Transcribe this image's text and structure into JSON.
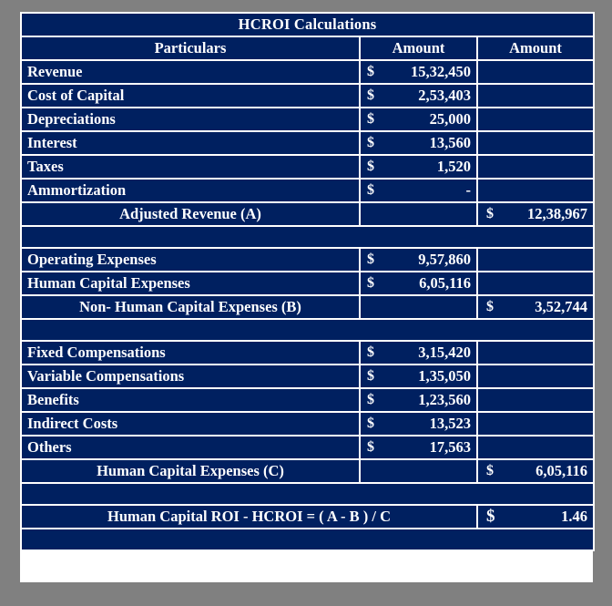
{
  "colors": {
    "navy": "#002060",
    "value_cell": "#dce6f1",
    "page_background": "#808080",
    "grid": "#ffffff"
  },
  "title": "HCROI Calculations",
  "columns": {
    "particulars": "Particulars",
    "amount_1": "Amount",
    "amount_2": "Amount"
  },
  "currency_symbol": "$",
  "sections": {
    "adjusted_revenue": {
      "rows": [
        {
          "label": "Revenue",
          "amount": "15,32,450"
        },
        {
          "label": "Cost of Capital",
          "amount": "2,53,403"
        },
        {
          "label": "Depreciations",
          "amount": "25,000"
        },
        {
          "label": "Interest",
          "amount": "13,560"
        },
        {
          "label": "Taxes",
          "amount": "1,520"
        },
        {
          "label": "Ammortization",
          "amount": "-"
        }
      ],
      "subtotal": {
        "label": "Adjusted Revenue (A)",
        "amount": "12,38,967"
      }
    },
    "non_human_capital": {
      "rows": [
        {
          "label": "Operating Expenses",
          "amount": "9,57,860"
        },
        {
          "label": "Human Capital Expenses",
          "amount": "6,05,116"
        }
      ],
      "subtotal": {
        "label": "Non- Human Capital Expenses (B)",
        "amount": "3,52,744"
      }
    },
    "human_capital": {
      "rows": [
        {
          "label": "Fixed Compensations",
          "amount": "3,15,420"
        },
        {
          "label": "Variable Compensations",
          "amount": "1,35,050"
        },
        {
          "label": "Benefits",
          "amount": "1,23,560"
        },
        {
          "label": "Indirect Costs",
          "amount": "13,523"
        },
        {
          "label": "Others",
          "amount": "17,563"
        }
      ],
      "subtotal": {
        "label": "Human Capital Expenses (C)",
        "amount": "6,05,116"
      }
    }
  },
  "result": {
    "label": "Human Capital ROI - HCROI = ( A - B ) / C",
    "value": "1.46"
  }
}
